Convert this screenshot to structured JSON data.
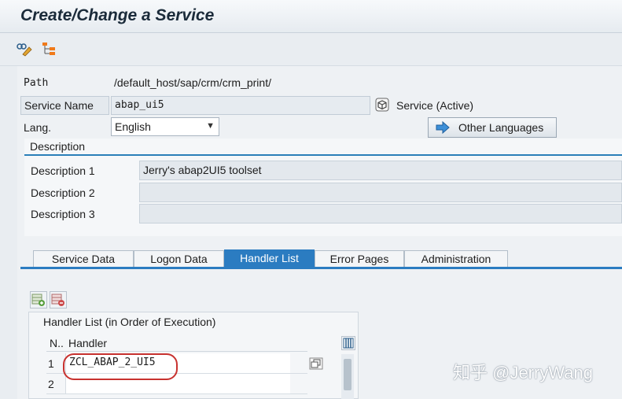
{
  "window": {
    "title": "Create/Change a Service"
  },
  "toolbar": {
    "icons": [
      "display-change-icon",
      "hierarchy-icon"
    ]
  },
  "service": {
    "path_label": "Path",
    "path_value": "/default_host/sap/crm/crm_print/",
    "name_label": "Service Name",
    "name_value": "abap_ui5",
    "status_text": "Service (Active)",
    "lang_label": "Lang.",
    "lang_value": "English",
    "other_languages_label": "Other Languages"
  },
  "description": {
    "header": "Description",
    "rows": [
      {
        "label": "Description 1",
        "value": "Jerry's abap2UI5 toolset"
      },
      {
        "label": "Description 2",
        "value": ""
      },
      {
        "label": "Description 3",
        "value": ""
      }
    ]
  },
  "tabs": [
    {
      "label": "Service Data",
      "active": false
    },
    {
      "label": "Logon Data",
      "active": false
    },
    {
      "label": "Handler List",
      "active": true
    },
    {
      "label": "Error Pages",
      "active": false
    },
    {
      "label": "Administration",
      "active": false
    }
  ],
  "handler_list": {
    "title": "Handler List (in Order of Execution)",
    "col_n": "N..",
    "col_handler": "Handler",
    "rows": [
      {
        "n": "1",
        "handler": "ZCL_ABAP_2_UI5"
      },
      {
        "n": "2",
        "handler": ""
      }
    ]
  },
  "watermark": "知乎 @JerryWang",
  "colors": {
    "accent": "#2b7cc1",
    "highlight": "#c8322f"
  }
}
